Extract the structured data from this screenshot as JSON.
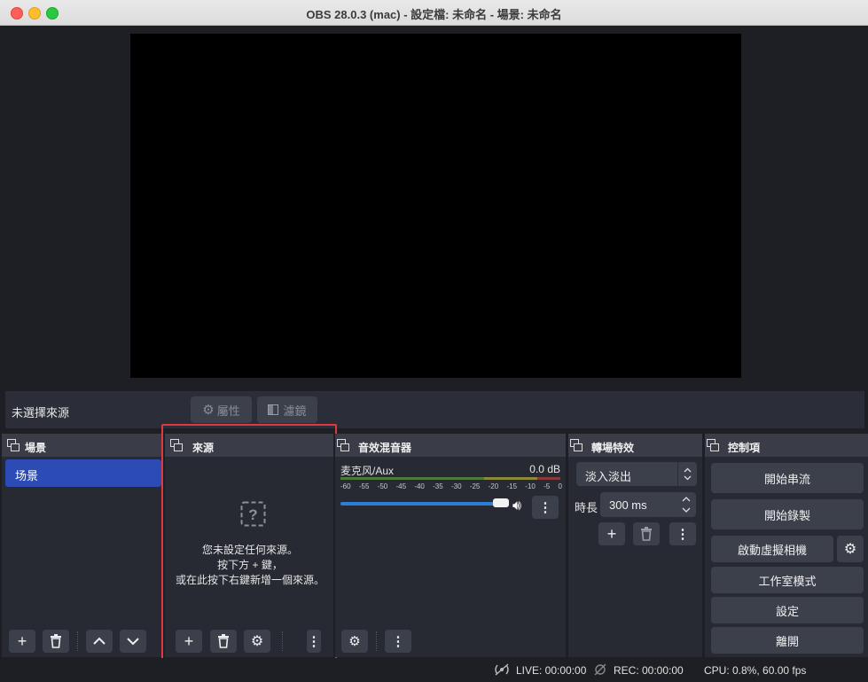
{
  "window": {
    "title": "OBS 28.0.3 (mac) - 設定檔: 未命名 - 場景: 未命名"
  },
  "source_toolbar": {
    "no_source_label": "未選擇來源",
    "properties_label": "屬性",
    "filters_label": "濾鏡"
  },
  "docks": {
    "scenes": {
      "title": "場景",
      "items": [
        "场景"
      ]
    },
    "sources": {
      "title": "來源",
      "empty_line1": "您未設定任何來源。",
      "empty_line2": "按下方 + 鍵，",
      "empty_line3": "或在此按下右鍵新增一個來源。"
    },
    "mixer": {
      "title": "音效混音器",
      "channel_name": "麦克风/Aux",
      "channel_db": "0.0 dB",
      "ticks": [
        "-60",
        "-55",
        "-50",
        "-45",
        "-40",
        "-35",
        "-30",
        "-25",
        "-20",
        "-15",
        "-10",
        "-5",
        "0"
      ],
      "volume_level": 1.0
    },
    "transitions": {
      "title": "轉場特效",
      "selected": "淡入淡出",
      "duration_label": "時長",
      "duration_value": "300 ms"
    },
    "controls": {
      "title": "控制項",
      "start_streaming": "開始串流",
      "start_recording": "開始錄製",
      "start_virtual_cam": "啟動虛擬相機",
      "studio_mode": "工作室模式",
      "settings": "設定",
      "exit": "離開"
    }
  },
  "status": {
    "live": "LIVE: 00:00:00",
    "rec": "REC: 00:00:00",
    "cpu": "CPU: 0.8%, 60.00 fps"
  },
  "colors": {
    "accent": "#2c4bb5",
    "highlight_frame": "#e03a40",
    "volume_fill": "#2b7fd6"
  }
}
